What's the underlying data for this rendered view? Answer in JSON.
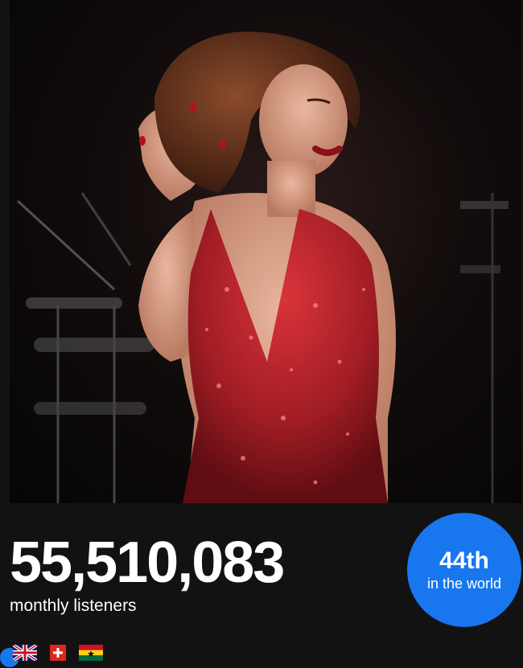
{
  "artist_image": {
    "alt": "artist-photo"
  },
  "stats": {
    "monthly_listeners_value": "55,510,083",
    "monthly_listeners_label": "monthly listeners"
  },
  "rank": {
    "value": "44th",
    "label": "in the world",
    "color": "#1877ee"
  },
  "flags": [
    {
      "icon": "uk-flag-icon"
    },
    {
      "icon": "switzerland-flag-icon"
    },
    {
      "icon": "ghana-flag-icon"
    }
  ],
  "colors": {
    "background": "#121212",
    "accent": "#1877ee"
  }
}
